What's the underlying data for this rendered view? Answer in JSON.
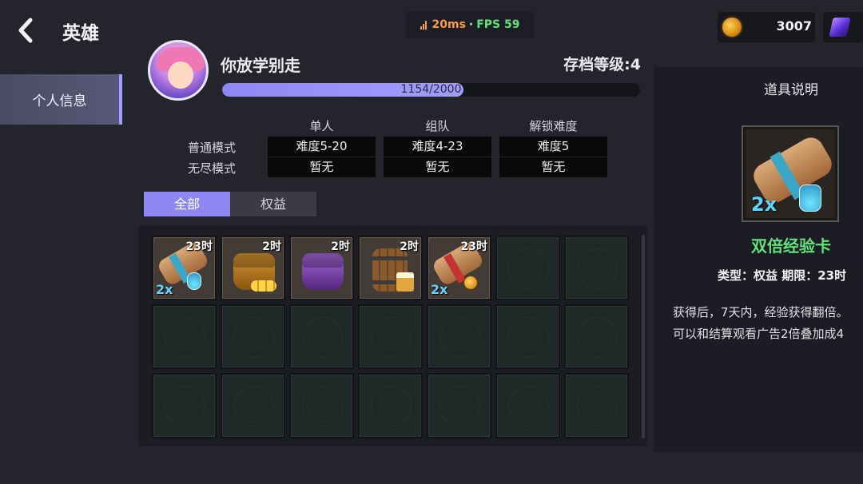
{
  "header": {
    "title": "英雄",
    "ping": "20ms",
    "separator": "·",
    "fps": "FPS 59",
    "coins": "3007"
  },
  "sidebar": {
    "items": [
      {
        "label": "个人信息",
        "active": true
      }
    ]
  },
  "profile": {
    "name": "你放学别走",
    "save_level": "存档等级:4",
    "xp_text": "1154/2000",
    "xp_fraction": 0.577
  },
  "difficulty": {
    "columns": [
      "单人",
      "组队",
      "解锁难度"
    ],
    "rows": [
      {
        "label": "普通模式",
        "cells": [
          "难度5-20",
          "难度4-23",
          "难度5"
        ]
      },
      {
        "label": "无尽模式",
        "cells": [
          "暂无",
          "暂无",
          "暂无"
        ]
      }
    ]
  },
  "filters": {
    "tabs": [
      {
        "label": "全部",
        "active": true
      },
      {
        "label": "权益",
        "active": false
      }
    ]
  },
  "inventory": {
    "items": [
      {
        "icon": "double-exp-scroll-icon",
        "timer": "23时",
        "mult": "2x"
      },
      {
        "icon": "gold-pouch-icon",
        "timer": "2时",
        "mult": ""
      },
      {
        "icon": "purple-bag-icon",
        "timer": "2时",
        "mult": ""
      },
      {
        "icon": "barrel-icon",
        "timer": "2时",
        "mult": ""
      },
      {
        "icon": "double-gold-scroll-icon",
        "timer": "23时",
        "mult": "2x"
      }
    ],
    "total_slots": 21
  },
  "detail": {
    "panel_title": "道具说明",
    "item_icon": "double-exp-scroll-icon",
    "item_mult": "2x",
    "item_name": "双倍经验卡",
    "meta": "类型：权益    期限：23时",
    "desc_line1": "获得后，7天内，经验获得翻倍。",
    "desc_line2": "可以和结算观看广告2倍叠加成4"
  },
  "colors": {
    "accent": "#8f88f2",
    "item_name": "#5fe37a",
    "ping": "#ff9b3d",
    "fps": "#5fe37a"
  }
}
